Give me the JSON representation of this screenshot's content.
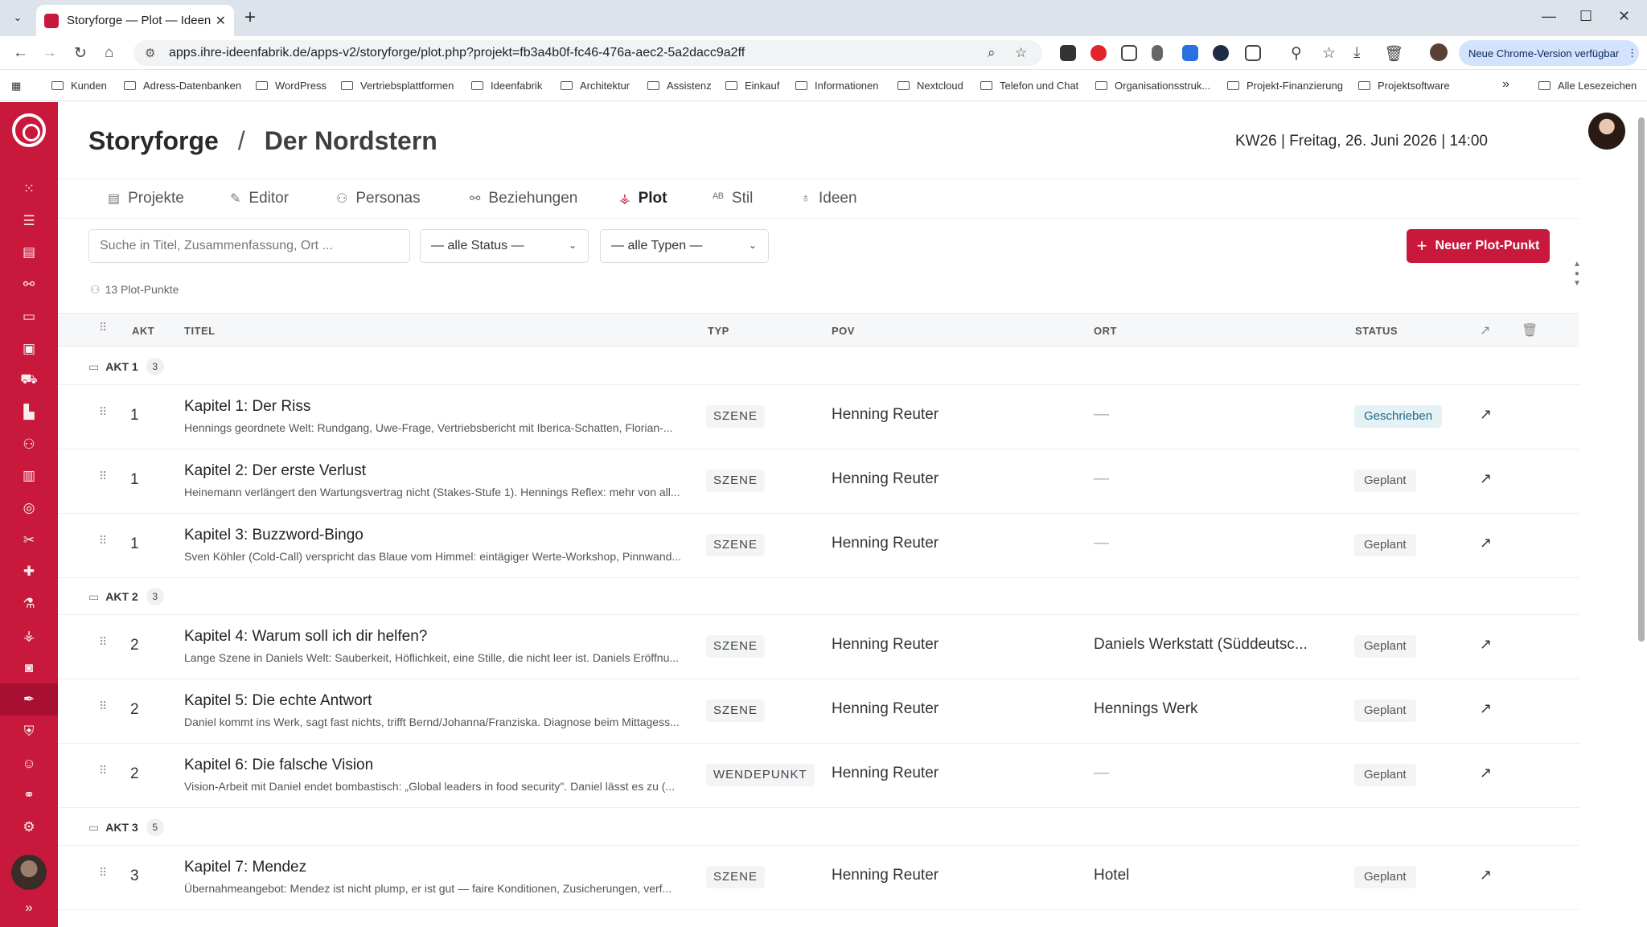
{
  "browser": {
    "tab_title": "Storyforge — Plot — Ideenfabr",
    "url": "apps.ihre-ideenfabrik.de/apps-v2/storyforge/plot.php?projekt=fb3a4b0f-fc46-476a-aec2-5a2dacc9a2ff",
    "update_label": "Neue Chrome-Version verfügbar",
    "bookmarks": [
      "Kunden",
      "Adress-Datenbanken",
      "WordPress",
      "Vertriebsplattformen",
      "Ideenfabrik",
      "Architektur",
      "Assistenz",
      "Einkauf",
      "Informationen",
      "Nextcloud",
      "Telefon und Chat",
      "Organisationsstruk...",
      "Projekt-Finanzierung",
      "Projektsoftware"
    ],
    "bookmarks_more": "»",
    "all_bookmarks": "Alle Lesezeichen"
  },
  "header": {
    "app_name": "Storyforge",
    "separator": "/",
    "project_name": "Der Nordstern",
    "date_info": "KW26 | Freitag, 26. Juni 2026 | 14:00"
  },
  "nav": {
    "tabs": [
      {
        "label": "Projekte",
        "icon": "document-icon"
      },
      {
        "label": "Editor",
        "icon": "pen-icon"
      },
      {
        "label": "Personas",
        "icon": "users-icon"
      },
      {
        "label": "Beziehungen",
        "icon": "relations-icon"
      },
      {
        "label": "Plot",
        "icon": "plot-icon",
        "active": true
      },
      {
        "label": "Stil",
        "icon": "style-icon"
      },
      {
        "label": "Ideen",
        "icon": "bulb-icon"
      }
    ]
  },
  "filters": {
    "search_placeholder": "Suche in Titel, Zusammenfassung, Ort ...",
    "status_value": "— alle Status —",
    "type_value": "— alle Typen —",
    "new_button": "Neuer Plot-Punkt"
  },
  "summary": {
    "count_label": "13 Plot-Punkte"
  },
  "table": {
    "headers": {
      "akt": "AKT",
      "titel": "TITEL",
      "typ": "TYP",
      "pov": "POV",
      "ort": "ORT",
      "status": "STATUS"
    },
    "acts": [
      {
        "label": "AKT 1",
        "count": "3"
      },
      {
        "label": "AKT 2",
        "count": "3"
      },
      {
        "label": "AKT 3",
        "count": "5"
      }
    ],
    "rows": [
      {
        "akt": "1",
        "title": "Kapitel 1: Der Riss",
        "summary": "Hennings geordnete Welt: Rundgang, Uwe-Frage, Vertriebsbericht mit Iberica-Schatten, Florian-...",
        "type": "SZENE",
        "pov": "Henning Reuter",
        "ort": "—",
        "status": "Geschrieben"
      },
      {
        "akt": "1",
        "title": "Kapitel 2: Der erste Verlust",
        "summary": "Heinemann verlängert den Wartungsvertrag nicht (Stakes-Stufe 1). Hennings Reflex: mehr von all...",
        "type": "SZENE",
        "pov": "Henning Reuter",
        "ort": "—",
        "status": "Geplant"
      },
      {
        "akt": "1",
        "title": "Kapitel 3: Buzzword-Bingo",
        "summary": "Sven Köhler (Cold-Call) verspricht das Blaue vom Himmel: eintägiger Werte-Workshop, Pinnwand...",
        "type": "SZENE",
        "pov": "Henning Reuter",
        "ort": "—",
        "status": "Geplant"
      },
      {
        "akt": "2",
        "title": "Kapitel 4: Warum soll ich dir helfen?",
        "summary": "Lange Szene in Daniels Welt: Sauberkeit, Höflichkeit, eine Stille, die nicht leer ist. Daniels Eröffnu...",
        "type": "SZENE",
        "pov": "Henning Reuter",
        "ort": "Daniels Werkstatt (Süddeutsc...",
        "status": "Geplant"
      },
      {
        "akt": "2",
        "title": "Kapitel 5: Die echte Antwort",
        "summary": "Daniel kommt ins Werk, sagt fast nichts, trifft Bernd/Johanna/Franziska. Diagnose beim Mittagess...",
        "type": "SZENE",
        "pov": "Henning Reuter",
        "ort": "Hennings Werk",
        "status": "Geplant"
      },
      {
        "akt": "2",
        "title": "Kapitel 6: Die falsche Vision",
        "summary": "Vision-Arbeit mit Daniel endet bombastisch: „Global leaders in food security\". Daniel lässt es zu (...",
        "type": "WENDEPUNKT",
        "pov": "Henning Reuter",
        "ort": "—",
        "status": "Geplant"
      },
      {
        "akt": "3",
        "title": "Kapitel 7: Mendez",
        "summary": "Übernahmeangebot: Mendez ist nicht plump, er ist gut — faire Konditionen, Zusicherungen, verf...",
        "type": "SZENE",
        "pov": "Henning Reuter",
        "ort": "Hotel",
        "status": "Geplant"
      }
    ]
  },
  "colors": {
    "accent": "#c8193c",
    "sidebar_active": "#a5102f",
    "status_done_bg": "#e4f2f6",
    "status_done_fg": "#1c6b84"
  }
}
